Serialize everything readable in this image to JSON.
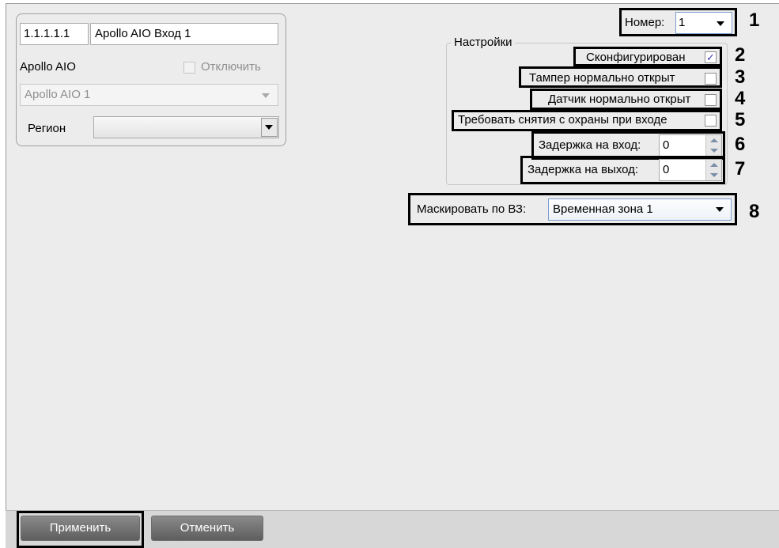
{
  "object": {
    "id": "1.1.1.1.1",
    "name": "Apollo AIO Вход 1",
    "parent_label": "Apollo AIO",
    "disable_label": "Отключить",
    "parent_select": "Apollo AIO 1",
    "region_label": "Регион",
    "region_value": ""
  },
  "number": {
    "label": "Номер:",
    "value": "1"
  },
  "settings": {
    "group_title": "Настройки",
    "configured": {
      "label": "Сконфигурирован",
      "checked": true
    },
    "tamper_nc": {
      "label": "Тампер нормально открыт",
      "checked": false
    },
    "sensor_nc": {
      "label": "Датчик нормально открыт",
      "checked": false
    },
    "require_disarm": {
      "label": "Требовать снятия с охраны при входе",
      "checked": false
    },
    "entry_delay": {
      "label": "Задержка на вход:",
      "value": "0"
    },
    "exit_delay": {
      "label": "Задержка на выход:",
      "value": "0"
    }
  },
  "mask": {
    "label": "Маскировать по ВЗ:",
    "value": "Временная зона 1"
  },
  "callouts": [
    "1",
    "2",
    "3",
    "4",
    "5",
    "6",
    "7",
    "8"
  ],
  "buttons": {
    "apply": "Применить",
    "cancel": "Отменить"
  },
  "colors": {
    "panel": "#ececec",
    "button": "#6e6e6e",
    "highlight": "#000000"
  }
}
